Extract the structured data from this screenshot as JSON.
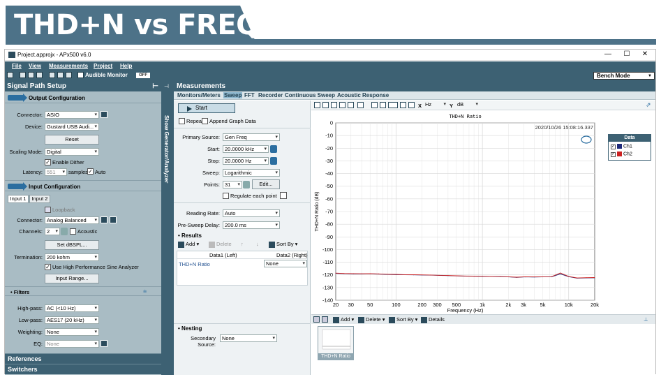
{
  "banner": {
    "title": "THD+N vs FREQ"
  },
  "window": {
    "title": "Project.approjx - APx500 v6.0",
    "minimize": "—",
    "maximize": "☐",
    "close": "✕"
  },
  "menu": {
    "file": "File",
    "view": "View",
    "measurements": "Measurements",
    "project": "Project",
    "help": "Help"
  },
  "toolbar": {
    "audible_monitor": "Audible Monitor",
    "monitor_state": "OFF",
    "mode": "Bench Mode"
  },
  "left_panel": {
    "title": "Signal Path Setup",
    "output": {
      "title": "Output Configuration",
      "connector_label": "Connector:",
      "connector_value": "ASIO",
      "device_label": "Device:",
      "device_value": "Gustard USB Audi...",
      "reset_label": "Reset",
      "scaling_label": "Scaling Mode:",
      "scaling_value": "Digital",
      "dither_label": "Enable Dither",
      "latency_label": "Latency:",
      "latency_value": "551",
      "latency_unit": "samples",
      "auto_label": "Auto"
    },
    "input": {
      "title": "Input Configuration",
      "tab1": "Input 1",
      "tab2": "Input 2",
      "loopback_label": "Loopback",
      "connector_label": "Connector:",
      "connector_value": "Analog Balanced",
      "channels_label": "Channels:",
      "channels_value": "2",
      "acoustic_label": "Acoustic",
      "dbspl_label": "Set dBSPL...",
      "termination_label": "Termination:",
      "termination_value": "200 kohm",
      "hp_sine_label": "Use High Performance Sine Analyzer",
      "input_range_label": "Input Range..."
    },
    "filters": {
      "title": "Filters",
      "highpass_label": "High-pass:",
      "highpass_value": "AC (<10 Hz)",
      "lowpass_label": "Low-pass:",
      "lowpass_value": "AES17 (20 kHz)",
      "weighting_label": "Weighting:",
      "weighting_value": "None",
      "eq_label": "EQ:",
      "eq_value": "None"
    },
    "references": "References",
    "switchers": "Switchers"
  },
  "vertical_strip": {
    "label": "Show Generator/Analyzer"
  },
  "measurements": {
    "title": "Measurements",
    "tabs": [
      "Monitors/Meters",
      "Sweep",
      "FFT",
      "Recorder",
      "Continuous Sweep",
      "Acoustic Response"
    ],
    "start_label": "Start",
    "repeat_label": "Repeat",
    "append_label": "Append Graph Data",
    "primary_source_label": "Primary Source:",
    "primary_source_value": "Gen Freq",
    "start_freq_label": "Start:",
    "start_freq_value": "20.0000 kHz",
    "stop_freq_label": "Stop:",
    "stop_freq_value": "20.0000 Hz",
    "sweep_label": "Sweep:",
    "sweep_value": "Logarithmic",
    "points_label": "Points:",
    "points_value": "31",
    "edit_label": "Edit...",
    "regulate_label": "Regulate each point",
    "reading_rate_label": "Reading Rate:",
    "reading_rate_value": "Auto",
    "presweep_label": "Pre-Sweep Delay:",
    "presweep_value": "200.0 ms",
    "results_title": "Results",
    "add_label": "Add",
    "delete_label": "Delete",
    "sort_label": "Sort By",
    "col1": "Data1 (Left)",
    "col2": "Data2 (Right)",
    "row_name": "THD+N Ratio",
    "row_value": "None",
    "nesting_title": "Nesting",
    "secondary_label": "Secondary Source:",
    "secondary_value": "None"
  },
  "graph": {
    "x_unit": "Hz",
    "y_unit": "dB",
    "x_axis_letter": "X",
    "y_axis_letter": "Y",
    "bottom_add": "Add",
    "bottom_delete": "Delete",
    "bottom_sort": "Sort By",
    "bottom_details": "Details",
    "thumb_label": "THD+N Ratio"
  },
  "chart_data": {
    "type": "line",
    "title": "THD+N Ratio",
    "timestamp": "2020/10/26 15:08:16.337",
    "xlabel": "Frequency (Hz)",
    "ylabel": "THD+N Ratio (dB)",
    "x_scale": "log",
    "xlim": [
      20,
      20000
    ],
    "ylim": [
      -140,
      0
    ],
    "xticks": [
      20,
      30,
      50,
      100,
      200,
      300,
      500,
      1000,
      2000,
      3000,
      5000,
      10000,
      20000
    ],
    "xtick_labels": [
      "20",
      "30",
      "50",
      "100",
      "200",
      "300",
      "500",
      "1k",
      "2k",
      "3k",
      "5k",
      "10k",
      "20k"
    ],
    "yticks": [
      0,
      -10,
      -20,
      -30,
      -40,
      -50,
      -60,
      -70,
      -80,
      -90,
      -100,
      -110,
      -120,
      -130,
      -140
    ],
    "ytick_labels": [
      "0",
      "-10",
      "-20",
      "-30",
      "-40",
      "-50",
      "-60",
      "-70",
      "-80",
      "-90",
      "-100",
      "-110",
      "-120",
      "-130",
      "-140"
    ],
    "grid": true,
    "legend_title": "Data",
    "legend_position": "top-right",
    "series": [
      {
        "name": "Ch1",
        "color": "#1f2a7a",
        "x": [
          20,
          25,
          32,
          40,
          50,
          63,
          80,
          100,
          125,
          160,
          200,
          250,
          315,
          400,
          500,
          630,
          800,
          1000,
          1250,
          1600,
          2000,
          2500,
          3150,
          4000,
          5000,
          6300,
          8000,
          10000,
          12500,
          16000,
          20000
        ],
        "y": [
          -118.8,
          -119.0,
          -119.2,
          -119.2,
          -119.1,
          -119.4,
          -119.6,
          -119.8,
          -119.9,
          -120.0,
          -120.1,
          -120.2,
          -120.4,
          -120.6,
          -120.8,
          -121.0,
          -121.1,
          -121.2,
          -121.3,
          -121.4,
          -121.6,
          -122.0,
          -121.6,
          -121.7,
          -121.6,
          -121.6,
          -119.2,
          -121.4,
          -122.6,
          -122.4,
          -122.3
        ]
      },
      {
        "name": "Ch2",
        "color": "#cc2222",
        "x": [
          20,
          25,
          32,
          40,
          50,
          63,
          80,
          100,
          125,
          160,
          200,
          250,
          315,
          400,
          500,
          630,
          800,
          1000,
          1250,
          1600,
          2000,
          2500,
          3150,
          4000,
          5000,
          6300,
          8000,
          10000,
          12500,
          16000,
          20000
        ],
        "y": [
          -118.6,
          -118.9,
          -119.0,
          -119.1,
          -119.0,
          -119.2,
          -119.5,
          -119.6,
          -119.8,
          -119.9,
          -120.0,
          -120.1,
          -120.3,
          -120.5,
          -120.7,
          -120.9,
          -121.0,
          -121.1,
          -121.2,
          -121.3,
          -121.5,
          -121.8,
          -121.5,
          -121.6,
          -121.5,
          -121.4,
          -118.5,
          -121.2,
          -122.4,
          -122.2,
          -122.1
        ]
      }
    ]
  }
}
